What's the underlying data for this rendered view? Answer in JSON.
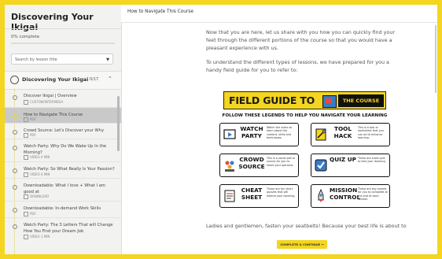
{
  "sidebar": {
    "course_title": "Discovering Your Ikigai",
    "progress_text": "0% complete",
    "progress_value": 0,
    "search_label": "Search by lesson title",
    "section": {
      "title": "Discovering Your Ikigai",
      "count": "0/17"
    },
    "lessons": [
      {
        "title": "Discover Ikigai | Overview",
        "type": "CUSTOM/INTERMIDIA"
      },
      {
        "title": "How to Navigate This Course",
        "type": "PDF"
      },
      {
        "title": "Crowd Source: Let's Discover your Why",
        "type": "PDF"
      },
      {
        "title": "Watch Party: Why Do We Wake Up In the Morning?",
        "type": "VIDEO 4 MIN"
      },
      {
        "title": "Watch Party: So What Really Is Your Passion?",
        "type": "VIDEO 4 MIN"
      },
      {
        "title": "Downloadable: What I love + What I am good at",
        "type": "DOWNLOAD"
      },
      {
        "title": "Downloadable: In-demand Work Skills",
        "type": "PDF"
      },
      {
        "title": "Watch Party: The 3 Letters That will Change How You Find your Dream Job",
        "type": "VIDEO 1 MIN"
      }
    ]
  },
  "header": {
    "breadcrumb": "How to Navigate This Course"
  },
  "content": {
    "para1": "Now that you are here, let us share with you how you can quickly find your feet through the different portions of the course so that you would have a pleasant experience with us.",
    "para2": "To understand the different types of lessons, we have prepared for you a handy field guide for you to refer to:",
    "guide_title_part1": "FIELD GUIDE TO",
    "guide_title_part2": "THE COURSE",
    "guide_subtitle": "FOLLOW THESE LEGENDS TO HELP YOU NAVIGATE YOUR LEARNING",
    "cards": [
      {
        "title": "WATCH PARTY",
        "desc": "Watch the video to learn about the content, skills and techniques.",
        "icon": "video-icon"
      },
      {
        "title": "TOOL HACK",
        "desc": "This is a tool or worksheet that you can do to enhance learning.",
        "icon": "tool-icon"
      },
      {
        "title": "CROWD SOURCE",
        "desc": "This is a social poll or survey for you to share your opinions.",
        "icon": "crowd-icon"
      },
      {
        "title": "QUIZ UP",
        "desc": "These are short quiz to test your learning.",
        "icon": "quiz-icon"
      },
      {
        "title": "CHEAT SHEET",
        "desc": "These are fun short quizzes that will extend your learning.",
        "icon": "cheat-sheet-icon"
      },
      {
        "title": "MISSION CONTROL",
        "desc": "These are key events for you to complete at the end of each section.",
        "icon": "mission-icon"
      }
    ],
    "para3": "Ladies and gentlemen, fasten your seatbelts! Because your best life is about to",
    "button_label": "COMPLETE & CONTINUE →"
  },
  "colors": {
    "accent": "#f4d51f",
    "frame": "#f4d51f"
  }
}
